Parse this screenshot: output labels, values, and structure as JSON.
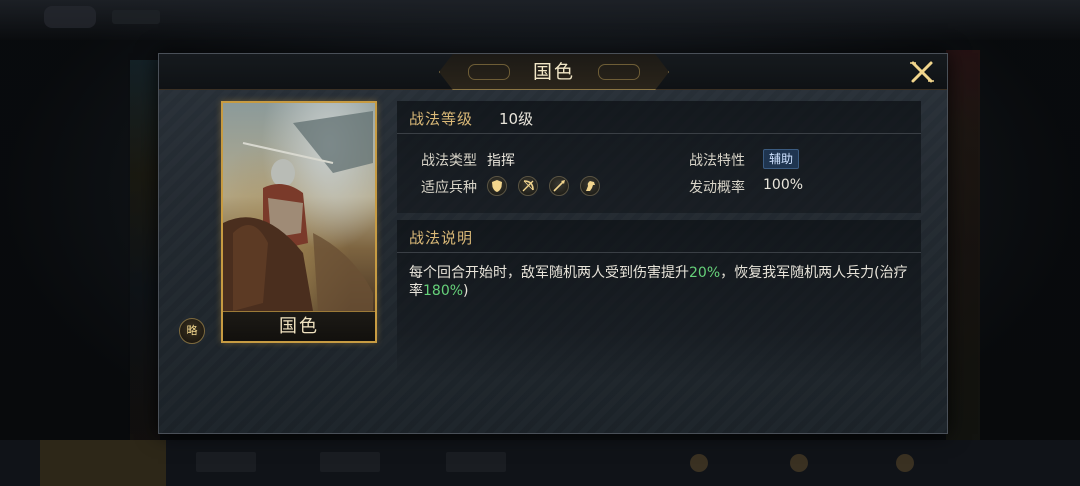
{
  "modal": {
    "title": "国色",
    "close_icon": "close-x-icon"
  },
  "card": {
    "name": "国色",
    "brief_label": "略"
  },
  "info": {
    "level_label": "战法等级",
    "level_value": "10级",
    "type_label": "战法类型",
    "type_value": "指挥",
    "trait_label": "战法特性",
    "trait_value": "辅助",
    "units_label": "适应兵种",
    "units": [
      "shield-icon",
      "bow-icon",
      "spear-icon",
      "horse-icon"
    ],
    "rate_label": "发动概率",
    "rate_value": "100%"
  },
  "description": {
    "label": "战法说明",
    "part1": "每个回合开始时，敌军随机两人受到伤害提升",
    "pct1": "20%",
    "part2": "，恢复我军随机两人兵力(治疗率",
    "pct2": "180%",
    "part3": ")"
  },
  "colors": {
    "accent_gold": "#d9b877",
    "highlight_green": "#66d17a",
    "card_border": "#c79b42"
  }
}
